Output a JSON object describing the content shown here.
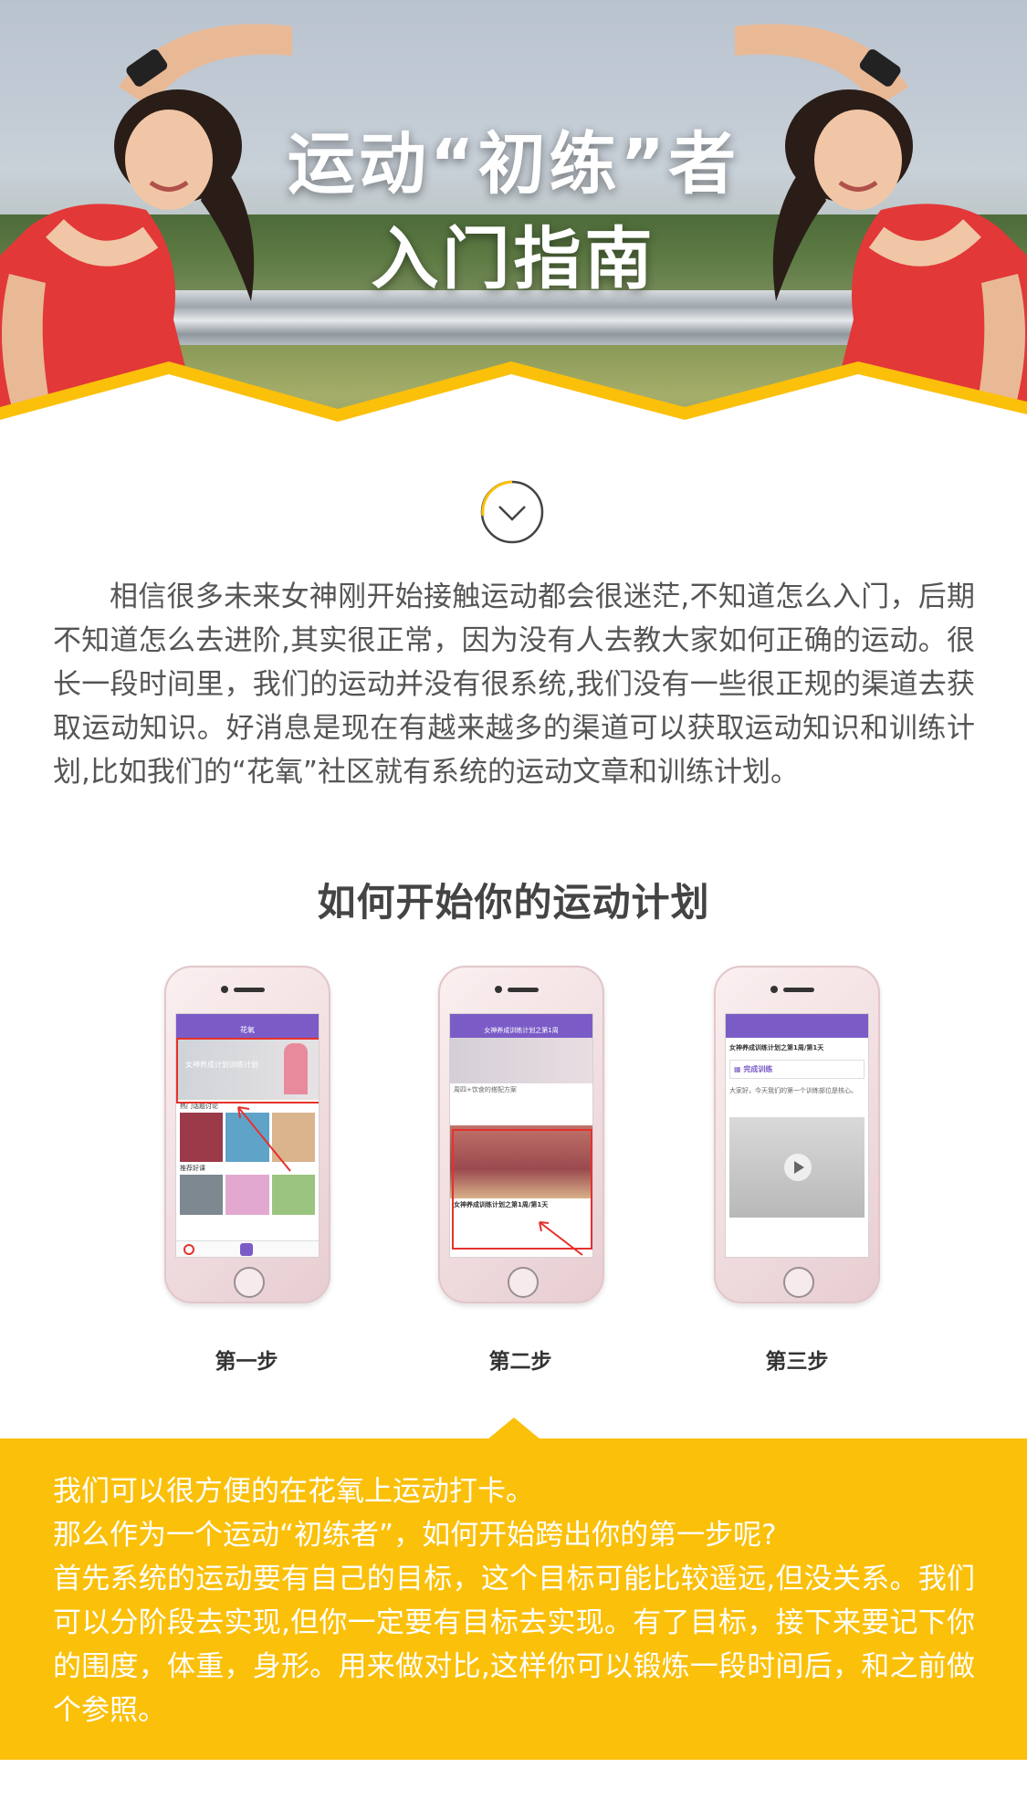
{
  "hero": {
    "title_line1": "运动“初练”者",
    "title_line2": "入门指南"
  },
  "intro": {
    "paragraph": "相信很多未来女神刚开始接触运动都会很迷茫,不知道怎么入门，后期不知道怎么去进阶,其实很正常，因为没有人去教大家如何正确的运动。很长一段时间里，我们的运动并没有很系统,我们没有一些很正规的渠道去获取运动知识。好消息是现在有越来越多的渠道可以获取运动知识和训练计划,比如我们的“花氧”社区就有系统的运动文章和训练计划。"
  },
  "section": {
    "title": "如何开始你的运动计划"
  },
  "phones": [
    {
      "step": "第一步",
      "nav_title": "花氧",
      "banner_text": "女神养成计划训练计划",
      "label_topics": "热门话题讨论",
      "label_recommend": "推荐好课"
    },
    {
      "step": "第二步",
      "nav_title": "女神养成训练计划之第1周",
      "body_text": "周四+饮食的搭配方案",
      "card_title": "女神养成训练计划之第1周/第1天"
    },
    {
      "step": "第三步",
      "article_title": "女神养成训练计划之第1周/第1天",
      "done_label": "完成训练",
      "body_text": "大家好，今天我们的第一个训练部位是核心。"
    }
  ],
  "yellow": {
    "line1": "我们可以很方便的在花氧上运动打卡。",
    "line2": "那么作为一个运动“初练者”，如何开始跨出你的第一步呢?",
    "line3": "首先系统的运动要有自己的目标，这个目标可能比较遥远,但没关系。我们可以分阶段去实现,但你一定要有目标去实现。有了目标，接下来要记下你的围度，体重，身形。用来做对比,这样你可以锻炼一段时间后，和之前做个参照。"
  },
  "colors": {
    "accent_yellow": "#fbc00a",
    "app_purple": "#7b5cc7",
    "highlight_red": "#e5322d",
    "text_gray": "#555555"
  }
}
